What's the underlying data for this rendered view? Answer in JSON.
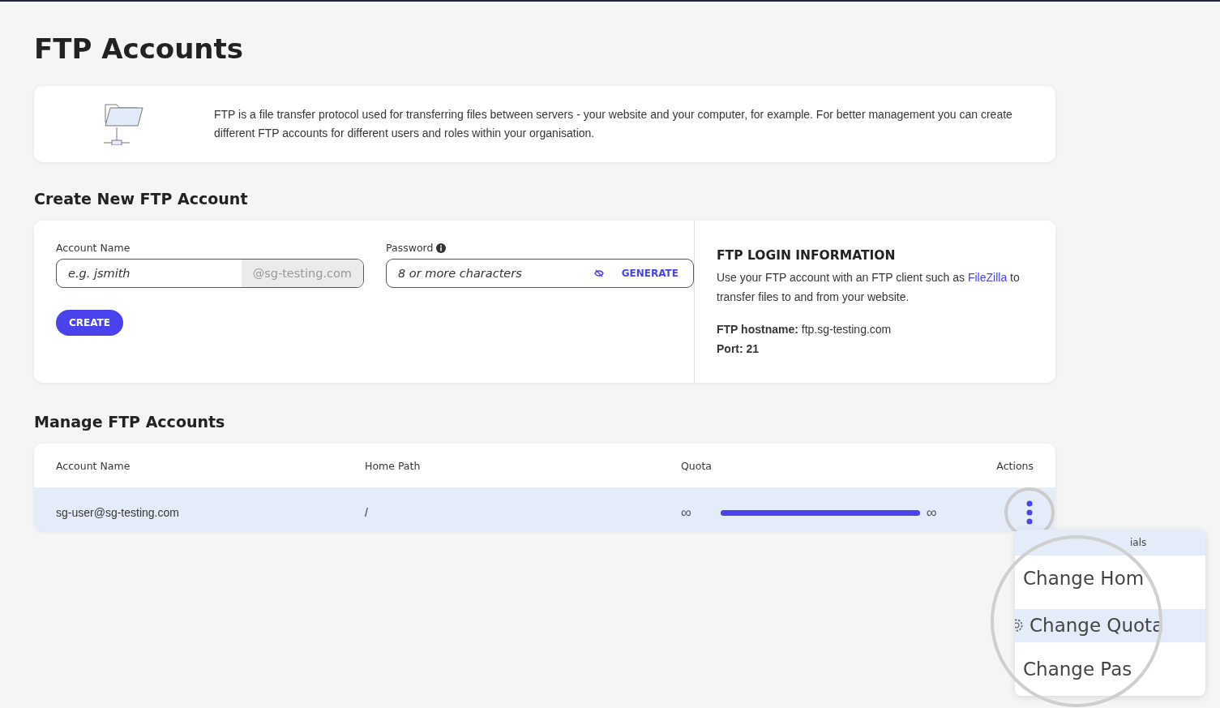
{
  "title": "FTP Accounts",
  "intro": {
    "text": "FTP is a file transfer protocol used for transferring files between servers - your website and your computer, for example. For better management you can create different FTP accounts for different users and roles within your organisation."
  },
  "create": {
    "heading": "Create New FTP Account",
    "account_name": {
      "label": "Account Name",
      "placeholder": "e.g. jsmith",
      "suffix": "@sg-testing.com"
    },
    "password": {
      "label": "Password",
      "placeholder": "8 or more characters",
      "generate": "GENERATE"
    },
    "create_button": "CREATE",
    "login_info": {
      "heading": "FTP LOGIN INFORMATION",
      "text_before": "Use your FTP account with an FTP client such as",
      "link": "FileZilla",
      "text_after": "to transfer files to and from your website.",
      "hostname": "**FTP hostname:** ftp.sg-testing.com",
      "port": "Port: 21"
    }
  },
  "manage": {
    "heading": "Manage FTP Accounts",
    "columns": [
      "Account Name",
      "Home Path",
      "Quota",
      "Actions"
    ],
    "rows": [
      {
        "account": "sg-user@sg-testing.com",
        "path": "/",
        "quota_used": "∞",
        "quota_total": "∞",
        "level": 1,
        "selected": true
      }
    ]
  },
  "menu": {
    "items": [
      {
        "label": "ials",
        "selected": true,
        "kind": "plain"
      },
      {
        "label": "Change Hom",
        "selected": false,
        "kind": "plain"
      },
      {
        "label": "Change Quota",
        "selected": true,
        "kind": "gear"
      },
      {
        "label": "Change Pas",
        "selected": false,
        "kind": "plain"
      }
    ]
  }
}
